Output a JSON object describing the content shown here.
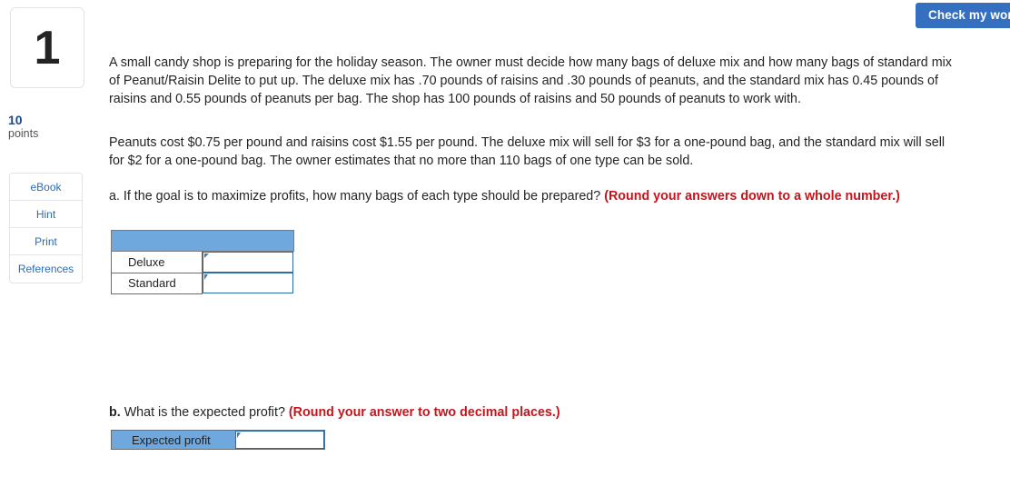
{
  "toolbar": {
    "check_my_work_label": "Check my work"
  },
  "question": {
    "number": "1",
    "points_value": "10",
    "points_label": "points"
  },
  "rail": {
    "buttons": [
      {
        "label": "eBook"
      },
      {
        "label": "Hint"
      },
      {
        "label": "Print"
      },
      {
        "label": "References"
      }
    ]
  },
  "body": {
    "paragraph1": "A small candy shop is preparing for the holiday season. The owner must decide how many bags of deluxe mix and how many bags of standard mix of Peanut/Raisin Delite to put up. The deluxe mix has .70 pounds of raisins and .30 pounds of peanuts, and the standard mix has 0.45 pounds of raisins and 0.55 pounds of peanuts per bag. The shop has 100 pounds of raisins and 50 pounds of peanuts to work with.",
    "paragraph2": "Peanuts cost $0.75 per pound and raisins cost $1.55 per pound. The deluxe mix will sell for $3 for a one-pound bag, and the standard mix will sell for $2 for a one-pound bag. The owner estimates that no more than 110 bags of one type can be sold.",
    "part_a_text": "a. If the goal is to maximize profits, how many bags of each type should be prepared? ",
    "part_a_note": "(Round your answers down to a whole number.)",
    "part_b_prefix": "b.",
    "part_b_text": " What is the expected profit? ",
    "part_b_note": "(Round your answer to two decimal places.)"
  },
  "answer_table": {
    "header_label": "",
    "rows": [
      {
        "label": "Deluxe",
        "value": "",
        "placeholder": ""
      },
      {
        "label": "Standard",
        "value": "",
        "placeholder": ""
      }
    ]
  },
  "profit": {
    "label": "Expected profit",
    "value": "",
    "placeholder": ""
  },
  "colors": {
    "accent_blue": "#3470bf",
    "table_header_blue": "#6fa8dd",
    "field_border_blue": "#2e6da4",
    "note_red": "#c4151c",
    "points_navy": "#1d4b81",
    "link_blue": "#2d6cb5"
  }
}
